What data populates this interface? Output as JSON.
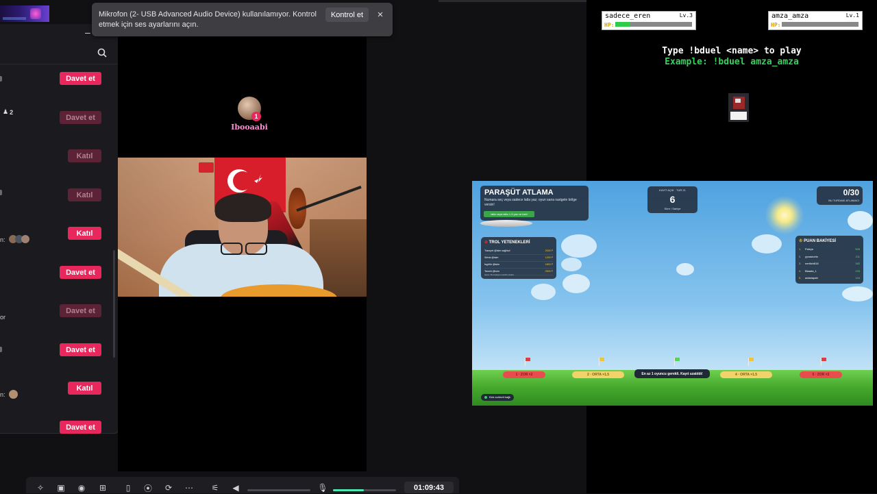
{
  "notification": {
    "text": "Mikrofon (2- USB Advanced Audio Device) kullanılamıyor. Kontrol etmek için ses ayarlarını açın.",
    "button": "Kontrol et",
    "close_icon": "×"
  },
  "sidebar": {
    "minimize_icon": "–",
    "close_icon": "✕",
    "search_icon": "search",
    "member_count": "2",
    "hints": [
      "n:",
      "or",
      "n:"
    ],
    "actions": [
      "Davet et",
      "Davet et",
      "Katıl",
      "Katıl",
      "Katıl",
      "Davet et",
      "Davet et",
      "Davet et",
      "Katıl",
      "Davet et"
    ]
  },
  "stream": {
    "avatar_name": "Ibooaabi",
    "badge": "1"
  },
  "duel": {
    "player1": {
      "name": "sadece_eren",
      "level": "Lv.3",
      "hp_label": "HP:",
      "hp_fraction": 0.2
    },
    "player2": {
      "name": "amza_amza",
      "level": "Lv.1",
      "hp_label": "HP:",
      "hp_fraction": 0.0
    },
    "instruction": "Type !bduel <name> to play",
    "example": "Example: !bduel amza_amza"
  },
  "game": {
    "title": "PARAŞÜT ATLAMA",
    "subtitle": "Numara seç veya sadece latla yaz; oyun sana rastgele bölge versin!",
    "plane_banner": "latla veya latla 1-5 yaz ve katıl",
    "timer_label": "KAYIT AÇIK · TUR 21",
    "timer_value": "6",
    "timer_sub": "Süre / Saniye",
    "count": "0/30",
    "count_label": "BU TURDAKİ ATLAMACI",
    "troll_title": "TROL YETENEKLERİ",
    "troll_items": [
      {
        "name": "Trampet @isim saği/sol",
        "cost": "2000 P"
      },
      {
        "name": "Sıfırla @isim",
        "cost": "1200 P"
      },
      {
        "name": "Isgüfür @isim",
        "cost": "1800 P"
      },
      {
        "name": "Tanrılıt @isim",
        "cost": "2500 P"
      }
    ],
    "troll_note": "Ipucu: Bu bakiyeni eksiltir ufakta.",
    "points_title": "PUAN BAKİYESİ",
    "points": [
      {
        "rank": "1.",
        "name": "Paleyn",
        "value": "526"
      },
      {
        "rank": "2.",
        "name": "yyvastorlin",
        "value": "211"
      },
      {
        "rank": "3.",
        "name": "nertlich818",
        "value": "182"
      },
      {
        "rank": "4.",
        "name": "Blaada_1",
        "value": "133"
      },
      {
        "rank": "5.",
        "name": "adastapatr",
        "value": "116"
      }
    ],
    "zones": [
      {
        "label": "1 · ZOR ×2",
        "kind": "red"
      },
      {
        "label": "2 · ORTA ×1.5",
        "kind": "yellow"
      },
      {
        "label": "En az 1 oyuncu gerekli. Kayıt uzatıldı!",
        "kind": "dark"
      },
      {
        "label": "4 · ORTA ×1.5",
        "kind": "yellow"
      },
      {
        "label": "5 · ZOR ×2",
        "kind": "red"
      }
    ],
    "connection": "Kick sohbeti bağlı"
  },
  "bottombar": {
    "time": "01:09:43",
    "volume_fraction": 0.0,
    "mic_fraction": 0.49
  },
  "colors": {
    "accent": "#e8285d",
    "accent_dim": "#5c2235",
    "hp_green": "#2ecc4a",
    "example_green": "#37d05d"
  }
}
